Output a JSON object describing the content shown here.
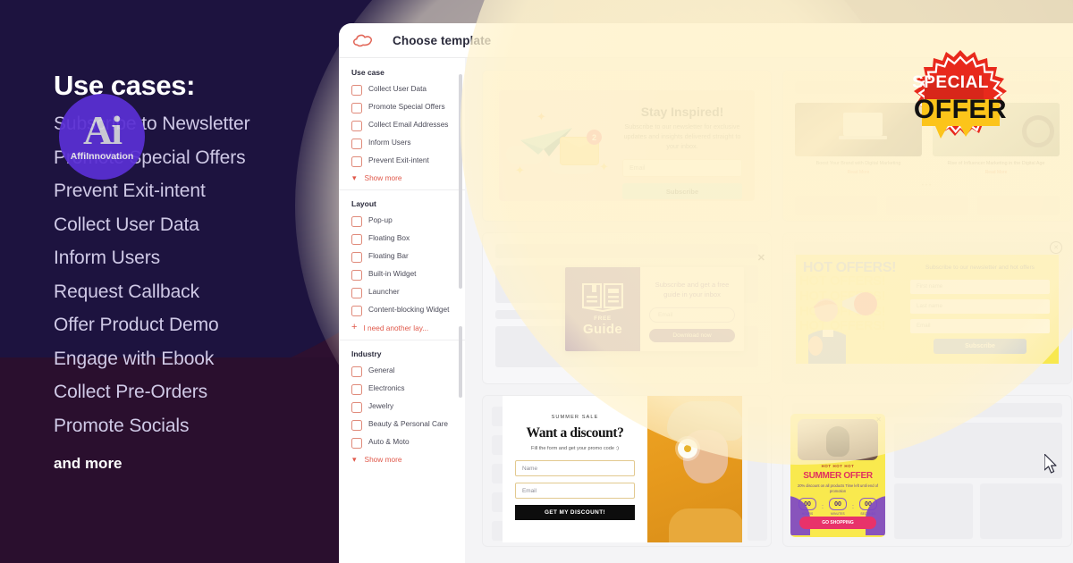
{
  "left_panel": {
    "title": "Use cases:",
    "items": [
      "Subscribe to Newsletter",
      "Promote Special Offers",
      "Prevent Exit-intent",
      "Collect User Data",
      "Inform Users",
      "Request Callback",
      "Offer Product Demo",
      "Engage with Ebook",
      "Collect Pre-Orders",
      "Promote Socials"
    ],
    "footer": "and more",
    "logo": {
      "mark": "Ai",
      "name": "AffiInnovation",
      "color": "#5a2fd4"
    }
  },
  "badge": {
    "line1": "SPECIAL",
    "line2": "OFFER",
    "red": "#e8291c",
    "yellow": "#fcc41a"
  },
  "app": {
    "header": {
      "title": "Choose template",
      "logo_icon": "cloud-icon"
    },
    "sidebar": {
      "groups": [
        {
          "heading": "Use case",
          "options": [
            "Collect User Data",
            "Promote Special Offers",
            "Collect Email Addresses",
            "Inform Users",
            "Prevent Exit-intent"
          ],
          "more_label": "Show more",
          "more_icon": "chevron-down-icon"
        },
        {
          "heading": "Layout",
          "options": [
            "Pop-up",
            "Floating Box",
            "Floating Bar",
            "Built-in Widget",
            "Launcher",
            "Content-blocking Widget"
          ],
          "more_label": "I need another lay...",
          "more_icon": "plus-icon"
        },
        {
          "heading": "Industry",
          "options": [
            "General",
            "Electronics",
            "Jewelry",
            "Beauty & Personal Care",
            "Auto & Moto"
          ],
          "more_label": "Show more",
          "more_icon": "chevron-down-icon"
        }
      ],
      "checkbox_color": "#e08a7a",
      "link_color": "#e0584a"
    },
    "templates": [
      {
        "id": "stay-inspired",
        "heading": "Stay Inspired!",
        "body": "Subscribe to our newsletter for exclusive updates and insights delivered straight to your inbox.",
        "input_placeholder": "Email",
        "button": "Subscribe",
        "badge_count": "2"
      },
      {
        "id": "digital-marketing-blog",
        "post1_title": "Boost Your Brand with Digital Marketing",
        "post1_link": "Read More",
        "post2_title": "Rise of Influencer Marketing in the Digital Age",
        "post2_link": "Read More"
      },
      {
        "id": "free-guide",
        "panel_kicker": "FREE",
        "panel_title": "Guide",
        "text": "Subscribe and get a free guide in your inbox",
        "input_placeholder": "Email",
        "button": "Download now",
        "close_icon": "close-icon"
      },
      {
        "id": "hot-offers",
        "heading": "HOT OFFERS!",
        "text": "Subscribe to our newsletter and hot offers",
        "input1_placeholder": "First name",
        "input2_placeholder": "Last name",
        "input3_placeholder": "Email",
        "button": "Subscribe",
        "close_icon": "close-circle-icon"
      },
      {
        "id": "summer-sale-discount",
        "kicker": "SUMMER SALE",
        "heading": "Want a discount?",
        "text": "Fill the form and get your promo code :)",
        "input1_placeholder": "Name",
        "input2_placeholder": "Email",
        "button": "GET MY DISCOUNT!"
      },
      {
        "id": "summer-offer-countdown",
        "kicker": "HOT HOT HOT",
        "heading": "SUMMER OFFER",
        "text": "20% discount on all products Time left until end of promotion",
        "timer": [
          {
            "value": "00",
            "label": "HOURS"
          },
          {
            "value": "00",
            "label": "MINUTES"
          },
          {
            "value": "00",
            "label": "SECONDS"
          }
        ],
        "button": "GO SHOPPING",
        "close_icon": "close-icon"
      }
    ]
  }
}
